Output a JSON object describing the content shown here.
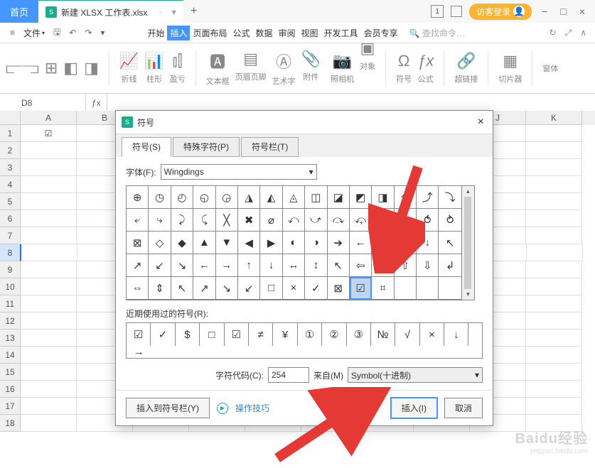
{
  "titlebar": {
    "home": "首页",
    "file_tab_icon": "S",
    "file_tab": "新建 XLSX 工作表.xlsx",
    "new_tab": "+",
    "guest": "访客登录",
    "box_num": "1"
  },
  "menubar": {
    "file_label": "文件",
    "items": [
      "开始",
      "插入",
      "页面布局",
      "公式",
      "数据",
      "审阅",
      "视图",
      "开发工具",
      "会员专享"
    ],
    "search_placeholder": "查找命令…"
  },
  "ribbon": {
    "g1": [
      "折线",
      "柱形",
      "盈亏"
    ],
    "g2": [
      "文本框",
      "页眉页脚",
      "艺术字",
      "附件"
    ],
    "camera": "照相机",
    "obj": "对象",
    "sym": "符号",
    "eq": "公式",
    "link": "超链接",
    "slicer": "切片器",
    "win": "窗体"
  },
  "cellref": "D8",
  "sheet": {
    "cols": [
      "A",
      "B",
      "",
      "",
      "",
      "",
      "",
      "",
      "J",
      "K"
    ],
    "cell_a1": "☑"
  },
  "dialog": {
    "title": "符号",
    "tabs": [
      "符号(S)",
      "特殊字符(P)",
      "符号栏(T)"
    ],
    "font_label": "字体(F):",
    "font_value": "Wingdings",
    "recent_label": "近期使用过的符号(R):",
    "code_label": "字符代码(C):",
    "code_value": "254",
    "from_label": "来自(M)",
    "from_value": "Symbol(十进制)",
    "insert_to_bar": "插入到符号栏(Y)",
    "tips": "操作技巧",
    "insert": "插入(I)",
    "cancel": "取消",
    "grid": [
      "⊕",
      "◷",
      "◴",
      "◵",
      "◶",
      "◮",
      "◭",
      "◬",
      "◫",
      "◪",
      "◩",
      "◨",
      "⟐",
      "⤴",
      "⤵",
      "⤶",
      "⤷",
      "⤸",
      "⤹",
      "╳",
      "✖",
      "⌀",
      "⤺",
      "⤻",
      "⤼",
      "⤽",
      "⤾",
      "⤿",
      "⥀",
      "⥁",
      "⊠",
      "◇",
      "◆",
      "▲",
      "▼",
      "◀",
      "▶",
      "◐",
      "◑",
      "➔",
      "←",
      "→",
      "↑",
      "↓",
      "↖",
      "↗",
      "↙",
      "↘",
      "←",
      "→",
      "↑",
      "↓",
      "↔",
      "↕",
      "↖",
      "⇦",
      "⇨",
      "⇧",
      "⇩",
      "↲",
      "⇔",
      "⇕",
      "↖",
      "↗",
      "↘",
      "↙",
      "□",
      "×",
      "✓",
      "⊠",
      "☑",
      "⌗",
      "",
      "",
      ""
    ],
    "selected_idx": 70,
    "recent": [
      "☑",
      "✓",
      "$",
      "□",
      "☑",
      "≠",
      "¥",
      "①",
      "②",
      "③",
      "№",
      "√",
      "×",
      "↓",
      "→"
    ]
  },
  "watermark": {
    "big": "Baidu经验",
    "small": "jingyan.baidu.com"
  }
}
